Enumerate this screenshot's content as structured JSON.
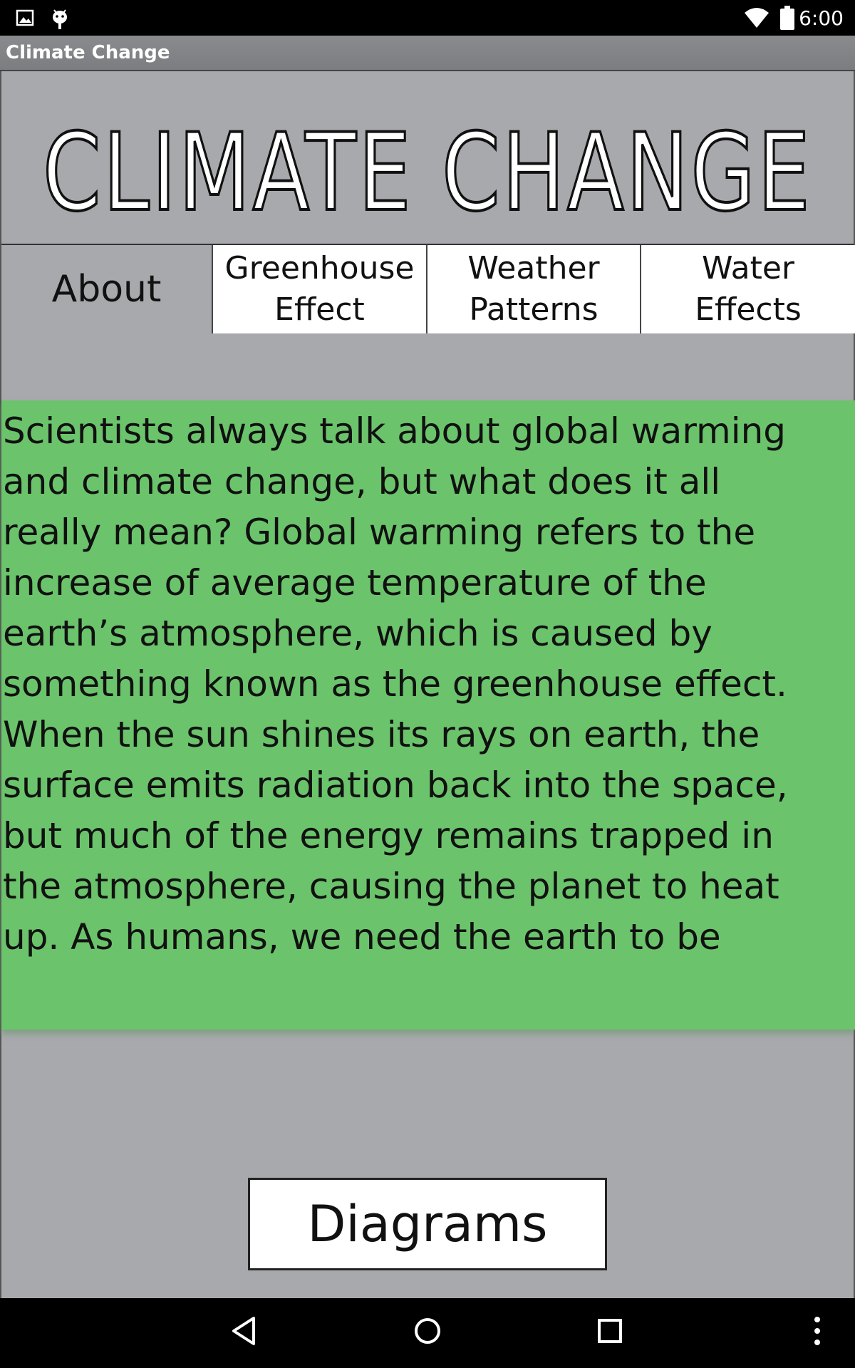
{
  "status_bar": {
    "time": "6:00",
    "icons": [
      "image-icon",
      "android-debug-icon",
      "wifi-icon",
      "battery-icon"
    ]
  },
  "action_bar": {
    "title": "Climate Change"
  },
  "banner": {
    "title": "Climate Change"
  },
  "tabs": [
    {
      "label": "About",
      "active": true
    },
    {
      "label": "Greenhouse\nEffect",
      "active": false
    },
    {
      "label": "Weather\nPatterns",
      "active": false
    },
    {
      "label": "Water\nEffects",
      "active": false
    }
  ],
  "content": {
    "text": "Scientists always talk about global warming\nand climate change, but what does it all\nreally mean?  Global warming refers to the\nincrease of average temperature of the\nearth’s atmosphere, which is caused by\nsomething known as the greenhouse effect.\nWhen the sun shines its rays on earth, the\nsurface emits radiation back into the space,\nbut much of the energy remains trapped in\nthe atmosphere, causing the planet to heat\nup. As humans, we need the earth to be"
  },
  "diagrams_button": {
    "label": "Diagrams"
  },
  "nav_bar": {
    "buttons": [
      "back-icon",
      "home-icon",
      "recents-icon",
      "overflow-menu-icon"
    ]
  },
  "colors": {
    "background": "#a8a9ad",
    "text_panel": "#6bc46b",
    "tab_inactive": "#ffffff"
  }
}
